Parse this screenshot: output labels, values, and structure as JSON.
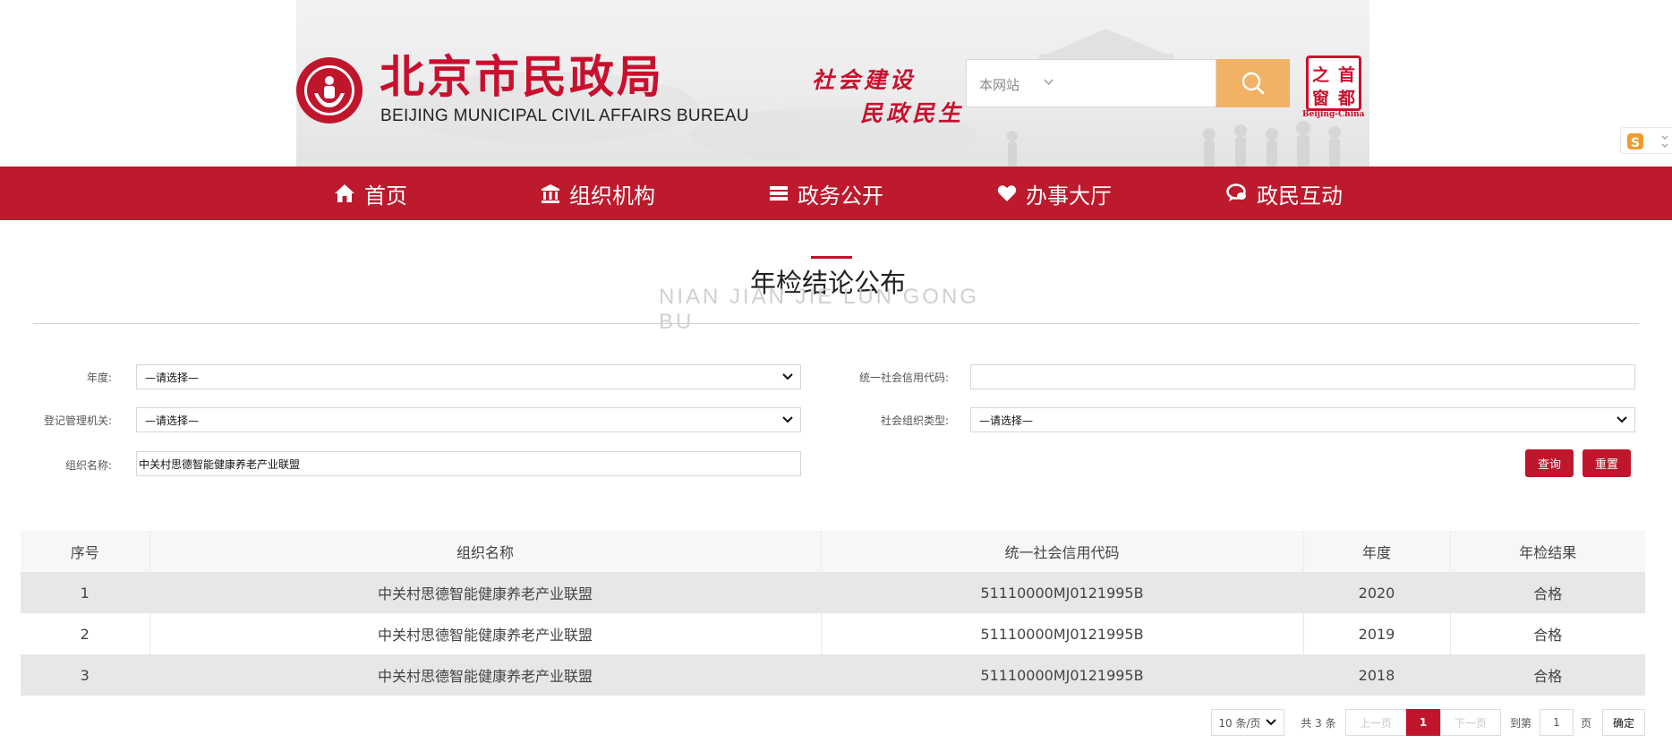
{
  "header": {
    "title_cn": "北京市民政局",
    "title_en": "BEIJING MUNICIPAL CIVIL AFFAIRS BUREAU",
    "slogan_line1": "社会建设",
    "slogan_line2": "民政民生",
    "search_scope": "本网站",
    "capital_logo_chars": [
      "首",
      "都",
      "之",
      "窗"
    ],
    "capital_logo_en": "Beijing-China"
  },
  "nav": {
    "items": [
      {
        "label": "首页",
        "icon": "home-icon"
      },
      {
        "label": "组织机构",
        "icon": "building-icon"
      },
      {
        "label": "政务公开",
        "icon": "list-icon"
      },
      {
        "label": "办事大厅",
        "icon": "heart-icon"
      },
      {
        "label": "政民互动",
        "icon": "chat-icon"
      }
    ]
  },
  "section": {
    "title": "年检结论公布",
    "subtitle": "NIAN JIAN JIE LUN GONG BU"
  },
  "form": {
    "year_label": "年度:",
    "year_value": "—请选择—",
    "credit_code_label": "统一社会信用代码:",
    "credit_code_value": "",
    "registry_label": "登记管理机关:",
    "registry_value": "—请选择—",
    "org_type_label": "社会组织类型:",
    "org_type_value": "—请选择—",
    "org_name_label": "组织名称:",
    "org_name_value": "中关村思德智能健康养老产业联盟",
    "query_button": "查询",
    "reset_button": "重置"
  },
  "table": {
    "headers": [
      "序号",
      "组织名称",
      "统一社会信用代码",
      "年度",
      "年检结果"
    ],
    "rows": [
      [
        "1",
        "中关村思德智能健康养老产业联盟",
        "51110000MJ0121995B",
        "2020",
        "合格"
      ],
      [
        "2",
        "中关村思德智能健康养老产业联盟",
        "51110000MJ0121995B",
        "2019",
        "合格"
      ],
      [
        "3",
        "中关村思德智能健康养老产业联盟",
        "51110000MJ0121995B",
        "2018",
        "合格"
      ]
    ]
  },
  "pagination": {
    "page_size": "10 条/页",
    "total": "共 3 条",
    "prev": "上一页",
    "current": "1",
    "next": "下一页",
    "goto_label": "到第",
    "goto_value": "1",
    "page_unit": "页",
    "confirm": "确定"
  },
  "colors": {
    "brand_red": "#bd1a2d",
    "search_button": "#f2b266",
    "stripe_row": "#e6e7e9"
  }
}
